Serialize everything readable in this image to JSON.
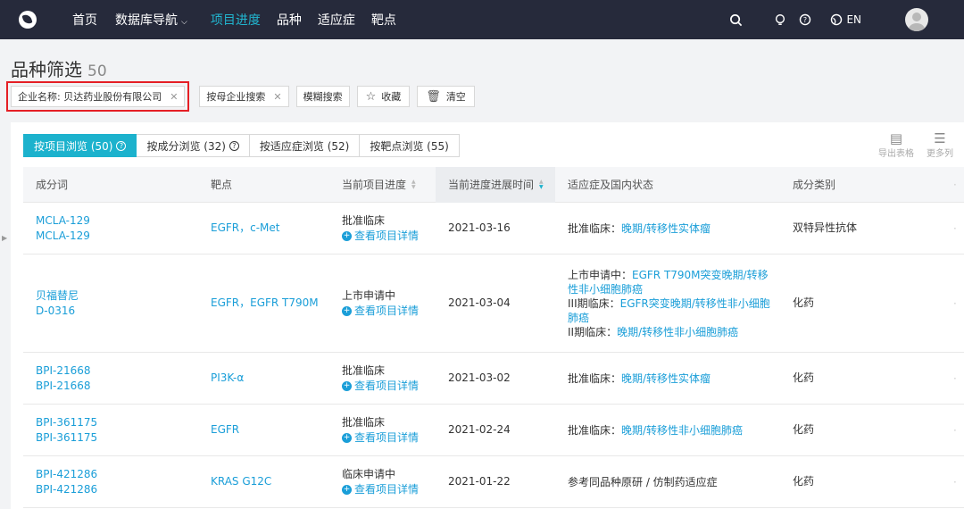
{
  "nav": {
    "items": [
      {
        "label": "首页",
        "active": false
      },
      {
        "label": "数据库导航",
        "active": false,
        "dropdown": true
      },
      {
        "label": "项目进度",
        "active": true
      },
      {
        "label": "品种",
        "active": false
      },
      {
        "label": "适应症",
        "active": false
      },
      {
        "label": "靶点",
        "active": false
      }
    ],
    "lang": "EN"
  },
  "page": {
    "title": "品种筛选",
    "count": "50"
  },
  "filters": {
    "company_chip": "企业名称: 贝达药业股份有限公司",
    "parent_search": "按母企业搜索",
    "fuzzy_search": "模糊搜索",
    "favorite": "收藏",
    "clear": "清空"
  },
  "tabs": [
    {
      "label": "按项目浏览 (50)",
      "active": true,
      "help": true
    },
    {
      "label": "按成分浏览 (32)",
      "active": false,
      "help": true
    },
    {
      "label": "按适应症浏览 (52)",
      "active": false,
      "help": false
    },
    {
      "label": "按靶点浏览 (55)",
      "active": false,
      "help": false
    }
  ],
  "tools": {
    "export": "导出表格",
    "more_cols": "更多列"
  },
  "table": {
    "headers": {
      "ingredient": "成分词",
      "target": "靶点",
      "progress": "当前项目进度",
      "time": "当前进度进展时间",
      "indication": "适应症及国内状态",
      "category": "成分类别"
    },
    "detail_label": "查看项目详情",
    "rows": [
      {
        "names": [
          "MCLA-129",
          "MCLA-129"
        ],
        "target": "EGFR，c-Met",
        "progress": "批准临床",
        "time": "2021-03-16",
        "indications": [
          {
            "label": "批准临床：",
            "value": "晚期/转移性实体瘤"
          }
        ],
        "category": "双特异性抗体",
        "show_detail": true
      },
      {
        "names": [
          "贝福替尼",
          "D-0316"
        ],
        "target": "EGFR，EGFR T790M",
        "progress": "上市申请中",
        "time": "2021-03-04",
        "indications": [
          {
            "label": "上市申请中：",
            "value": "EGFR T790M突变晚期/转移性非小细胞肺癌"
          },
          {
            "label": "III期临床：",
            "value": "EGFR突变晚期/转移性非小细胞肺癌"
          },
          {
            "label": "II期临床：",
            "value": "晚期/转移性非小细胞肺癌"
          }
        ],
        "category": "化药",
        "show_detail": true
      },
      {
        "names": [
          "BPI-21668",
          "BPI-21668"
        ],
        "target": "PI3K-α",
        "progress": "批准临床",
        "time": "2021-03-02",
        "indications": [
          {
            "label": "批准临床：",
            "value": "晚期/转移性实体瘤"
          }
        ],
        "category": "化药",
        "show_detail": true
      },
      {
        "names": [
          "BPI-361175",
          "BPI-361175"
        ],
        "target": "EGFR",
        "progress": "批准临床",
        "time": "2021-02-24",
        "indications": [
          {
            "label": "批准临床：",
            "value": "晚期/转移性非小细胞肺癌"
          }
        ],
        "category": "化药",
        "show_detail": true
      },
      {
        "names": [
          "BPI-421286",
          "BPI-421286"
        ],
        "target": "KRAS G12C",
        "progress": "临床申请中",
        "time": "2021-01-22",
        "indications": [
          {
            "label": "参考同品种原研 / 仿制药适应症",
            "value": ""
          }
        ],
        "category": "化药",
        "show_detail": true
      }
    ]
  },
  "colors": {
    "nav_bg": "#262a3b",
    "accent": "#1cb2cd",
    "link": "#1a9ed8",
    "highlight": "#e51f25"
  }
}
